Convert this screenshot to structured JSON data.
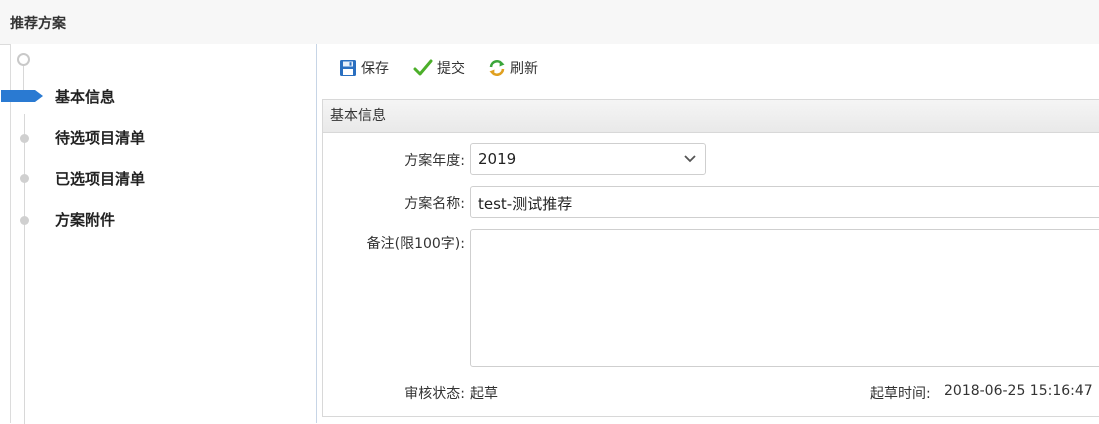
{
  "page": {
    "title": "推荐方案"
  },
  "steps": [
    {
      "label": "基本信息",
      "active": true
    },
    {
      "label": "待选项目清单",
      "active": false
    },
    {
      "label": "已选项目清单",
      "active": false
    },
    {
      "label": "方案附件",
      "active": false
    }
  ],
  "toolbar": {
    "save": "保存",
    "submit": "提交",
    "refresh": "刷新"
  },
  "section": {
    "title": "基本信息"
  },
  "form": {
    "year_label": "方案年度:",
    "year_value": "2019",
    "name_label": "方案名称:",
    "name_value": "test-测试推荐",
    "remark_label": "备注(限100字):",
    "remark_value": "",
    "audit_label": "审核状态:",
    "audit_value": "起草",
    "draft_time_label": "起草时间:",
    "draft_time_value": "2018-06-25 15:16:47"
  },
  "colors": {
    "accent": "#2a7ad2",
    "check": "#4caf2a",
    "refresh": "#3aa53a"
  }
}
